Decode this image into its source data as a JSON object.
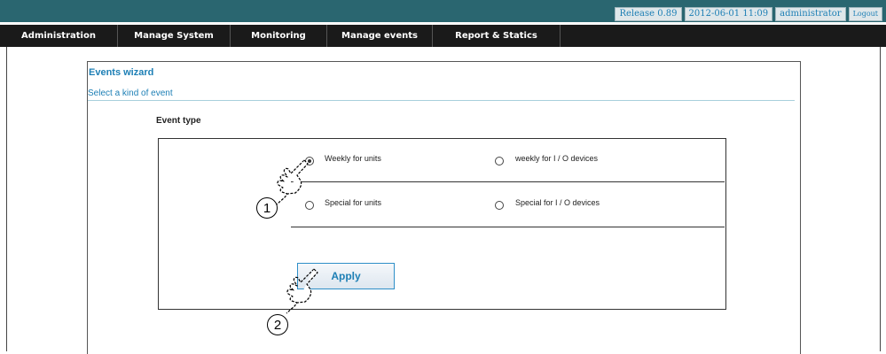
{
  "topbar": {
    "release": "Release 0.89",
    "datetime": "2012-06-01 11:09",
    "user": "administrator",
    "logout": "Logout"
  },
  "nav": {
    "items": [
      {
        "label": "Administration"
      },
      {
        "label": "Manage System"
      },
      {
        "label": "Monitoring"
      },
      {
        "label": "Manage events"
      },
      {
        "label": "Report & Statics"
      }
    ]
  },
  "wizard": {
    "title": "Events wizard",
    "subtitle": "Select a kind of event",
    "event_type_label": "Event type",
    "options": [
      {
        "label": "Weekly for units",
        "selected": true
      },
      {
        "label": "weekly for I / O devices",
        "selected": false
      },
      {
        "label": "Special for units",
        "selected": false
      },
      {
        "label": "Special for I / O devices",
        "selected": false
      }
    ],
    "apply_label": "Apply"
  },
  "callouts": [
    "1",
    "2"
  ],
  "colors": {
    "topbar": "#2a6670",
    "navbar": "#1a1a1a",
    "accent": "#1d7fb5"
  },
  "icons": [
    "pointing-hand-icon"
  ]
}
